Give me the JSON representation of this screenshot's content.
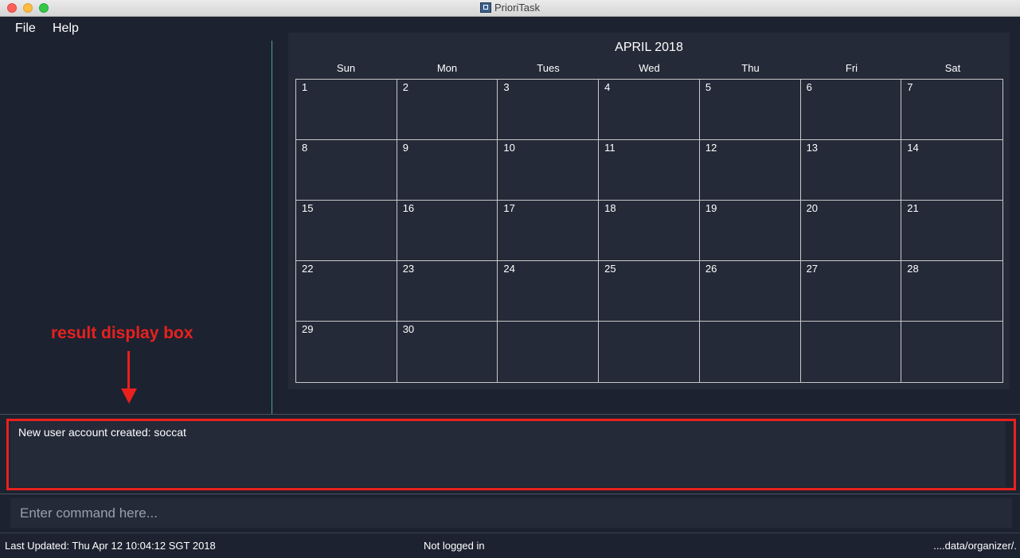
{
  "window": {
    "title": "PrioriTask"
  },
  "menu": {
    "file": "File",
    "help": "Help"
  },
  "calendar": {
    "title": "APRIL 2018",
    "days": [
      "Sun",
      "Mon",
      "Tues",
      "Wed",
      "Thu",
      "Fri",
      "Sat"
    ],
    "dates": [
      "1",
      "2",
      "3",
      "4",
      "5",
      "6",
      "7",
      "8",
      "9",
      "10",
      "11",
      "12",
      "13",
      "14",
      "15",
      "16",
      "17",
      "18",
      "19",
      "20",
      "21",
      "22",
      "23",
      "24",
      "25",
      "26",
      "27",
      "28",
      "29",
      "30",
      "",
      "",
      "",
      "",
      ""
    ]
  },
  "result": {
    "text": "New user account created: soccat"
  },
  "command": {
    "placeholder": "Enter command here..."
  },
  "status": {
    "last_updated": "Last Updated: Thu Apr 12 10:04:12 SGT 2018",
    "login": "Not logged in",
    "path": "....data/organizer/."
  },
  "annotation": {
    "label": "result display box"
  },
  "colors": {
    "accent_red": "#e8211d",
    "background": "#1d2230",
    "panel": "#242a38"
  }
}
